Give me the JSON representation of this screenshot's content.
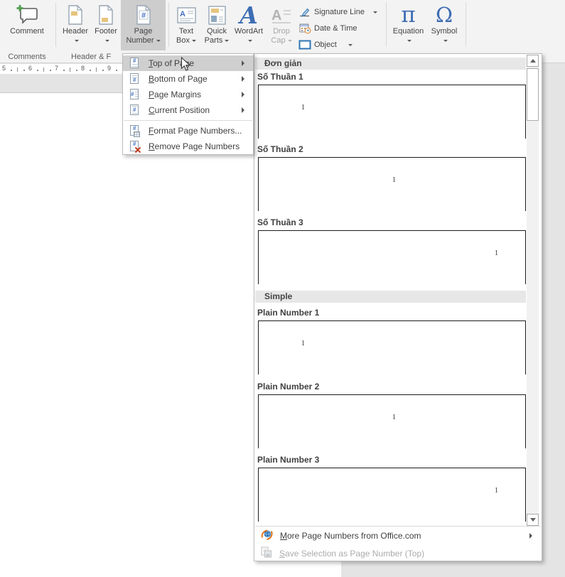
{
  "ribbon": {
    "group_labels": {
      "comments": "Comments",
      "header_footer": "Header & F"
    },
    "buttons": {
      "comment": "Comment",
      "header": "Header",
      "footer": "Footer",
      "page_number_line1": "Page",
      "page_number_line2": "Number",
      "text_box_line1": "Text",
      "text_box_line2": "Box",
      "quick_parts_line1": "Quick",
      "quick_parts_line2": "Parts",
      "wordart": "WordArt",
      "drop_cap_line1": "Drop",
      "drop_cap_line2": "Cap",
      "signature_line": "Signature Line",
      "date_time": "Date & Time",
      "object": "Object",
      "equation": "Equation",
      "symbol": "Symbol"
    }
  },
  "ruler": {
    "numbers": [
      "5",
      "6",
      "7",
      "8",
      "9"
    ]
  },
  "menu": {
    "items": [
      {
        "label": "Top of Page",
        "has_submenu": true,
        "highlighted": true,
        "icon": "page-number-top-icon"
      },
      {
        "label": "Bottom of Page",
        "has_submenu": true,
        "highlighted": false,
        "icon": "page-number-bottom-icon"
      },
      {
        "label": "Page Margins",
        "has_submenu": true,
        "highlighted": false,
        "icon": "page-margins-icon"
      },
      {
        "label": "Current Position",
        "has_submenu": true,
        "highlighted": false,
        "icon": "current-position-icon"
      },
      {
        "label": "Format Page Numbers...",
        "has_submenu": false,
        "highlighted": false,
        "icon": "format-page-numbers-icon"
      },
      {
        "label": "Remove Page Numbers",
        "has_submenu": false,
        "highlighted": false,
        "icon": "remove-page-numbers-icon"
      }
    ]
  },
  "gallery": {
    "preview_number": "1",
    "sections": [
      {
        "header": "Đơn giản",
        "items": [
          {
            "label": "Số Thuần 1",
            "align": "pos-left"
          },
          {
            "label": "Số Thuần 2",
            "align": "pos-center"
          },
          {
            "label": "Số Thuần 3",
            "align": "pos-right"
          }
        ]
      },
      {
        "header": "Simple",
        "items": [
          {
            "label": "Plain Number 1",
            "align": "pos-left"
          },
          {
            "label": "Plain Number 2",
            "align": "pos-center"
          },
          {
            "label": "Plain Number 3",
            "align": "pos-right"
          }
        ]
      }
    ],
    "footer_items": [
      {
        "label": "More Page Numbers from Office.com",
        "enabled": true,
        "has_submenu": true,
        "icon": "office-com-icon"
      },
      {
        "label": "Save Selection as Page Number (Top)",
        "enabled": false,
        "has_submenu": false,
        "icon": "save-selection-icon"
      }
    ]
  },
  "colors": {
    "accent_blue": "#4472c4",
    "icon_blue": "#3e6db3",
    "menu_highlight": "#cfcfcf",
    "tan_bar": "#e6c57f",
    "green_plus": "#4f9e4f",
    "red_x": "#c23b22",
    "orange_swoosh": "#e36c09",
    "disabled_text": "#ababab"
  }
}
